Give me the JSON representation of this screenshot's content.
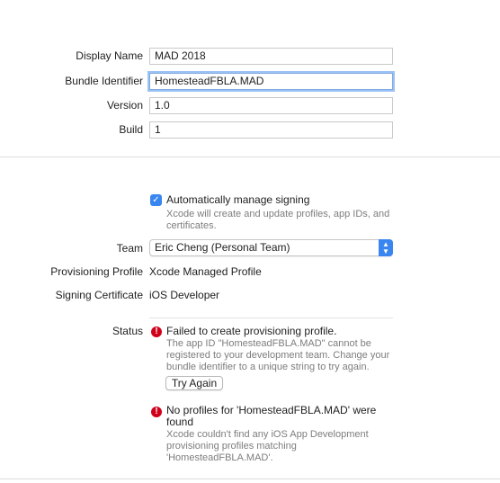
{
  "identity": {
    "display_name_label": "Display Name",
    "display_name_value": "MAD 2018",
    "bundle_identifier_label": "Bundle Identifier",
    "bundle_identifier_value": "HomesteadFBLA.MAD",
    "version_label": "Version",
    "version_value": "1.0",
    "build_label": "Build",
    "build_value": "1"
  },
  "signing": {
    "auto_manage_label": "Automatically manage signing",
    "auto_manage_checked": true,
    "auto_manage_help_1": "Xcode will create and update profiles, app IDs, and",
    "auto_manage_help_2": "certificates.",
    "team_label": "Team",
    "team_value": "Eric Cheng (Personal Team)",
    "provisioning_profile_label": "Provisioning Profile",
    "provisioning_profile_value": "Xcode Managed Profile",
    "signing_certificate_label": "Signing Certificate",
    "signing_certificate_value": "iOS Developer"
  },
  "status": {
    "label": "Status",
    "error1_title": "Failed to create provisioning profile.",
    "error1_desc_1": "The app ID \"HomesteadFBLA.MAD\" cannot be",
    "error1_desc_2": "registered to your development team. Change your",
    "error1_desc_3": "bundle identifier to a unique string to try again.",
    "try_again_label": "Try Again",
    "error2_title_1": "No profiles for 'HomesteadFBLA.MAD' were",
    "error2_title_2": "found",
    "error2_desc_1": "Xcode couldn't find any iOS App Development",
    "error2_desc_2": "provisioning profiles matching",
    "error2_desc_3": "'HomesteadFBLA.MAD'."
  },
  "icons": {
    "check": "checkmark-icon",
    "error": "error-icon",
    "stepper": "chevron-updown-icon"
  },
  "colors": {
    "accent": "#3a86f0",
    "error": "#d0021b",
    "help_text": "#7d7d7d"
  }
}
